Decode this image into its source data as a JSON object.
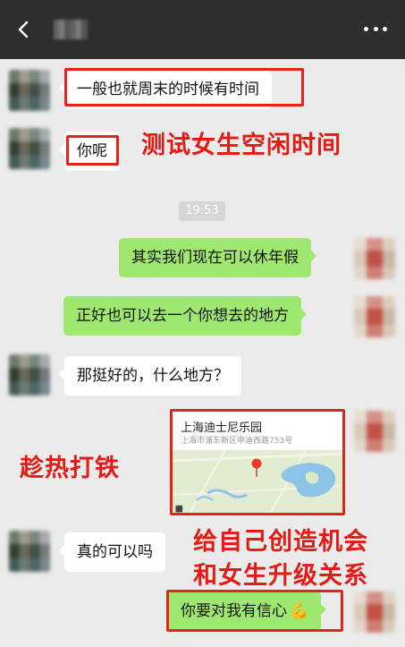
{
  "header": {
    "contact_name_blurred": true,
    "more_label": "•••"
  },
  "messages": {
    "m1": "一般也就周末的时候有时间",
    "m2": "你呢",
    "timestamp": "19:53",
    "m3": "其实我们现在可以休年假",
    "m4": "正好也可以去一个你想去的地方",
    "m5": "那挺好的，什么地方？",
    "m6_location_name": "上海迪士尼乐园",
    "m6_location_address": "上海市浦东新区申迪西路753号",
    "m7": "真的可以吗",
    "m8": "你要对我有信心",
    "m8_emoji": "💪"
  },
  "annotations": {
    "a1": "测试女生空闲时间",
    "a2": "趁热打铁",
    "a3_line1": "给自己创造机会",
    "a3_line2": "和女生升级关系"
  },
  "colors": {
    "header_bg": "#2e2e2e",
    "chat_bg": "#ebebeb",
    "green_bubble": "#9fe870",
    "white_bubble": "#ffffff",
    "annotation_red": "#e41b14"
  },
  "icons": [
    "back-arrow-icon",
    "more-icon",
    "map-pin-icon",
    "muscle-emoji-icon"
  ]
}
